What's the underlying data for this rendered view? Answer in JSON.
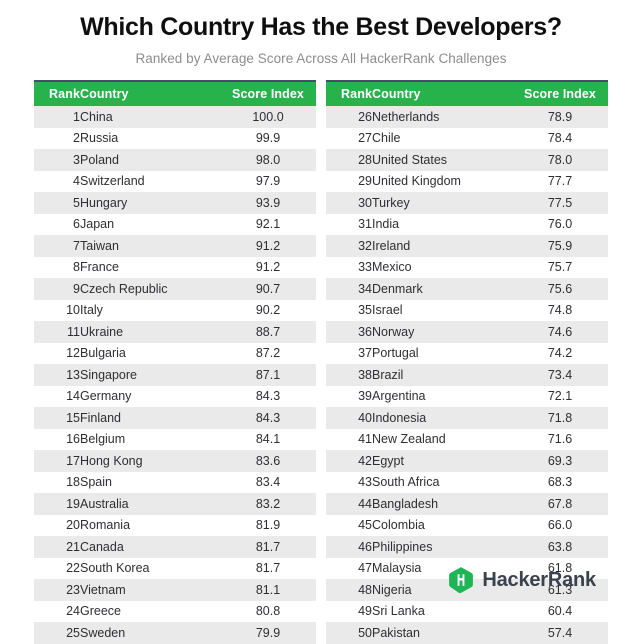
{
  "header": {
    "title": "Which Country Has the Best Developers?",
    "subtitle": "Ranked by Average Score Across All HackerRank Challenges"
  },
  "columns": {
    "rank": "Rank",
    "country": "Country",
    "score": "Score Index"
  },
  "colors": {
    "header_green": "#27b24b",
    "row_shaded": "#eaeaea",
    "row_plain": "#ffffff",
    "logo_green": "#1fb455",
    "logo_text": "#39424e",
    "title_text": "#0f0f0f",
    "subtitle_text": "#8d8d8d",
    "table_top_rule": "#4a4a6a"
  },
  "footer": {
    "logo_name": "HackerRank",
    "logo_letter": "H",
    "logo_icon": "hackerrank-hexagon-icon"
  },
  "chart_data": {
    "type": "table",
    "title": "Which Country Has the Best Developers?",
    "subtitle": "Ranked by Average Score Across All HackerRank Challenges",
    "columns": [
      "Rank",
      "Country",
      "Score Index"
    ],
    "xlabel": "",
    "ylabel": "Score Index",
    "ylim": [
      57.4,
      100.0
    ],
    "categories": [
      "China",
      "Russia",
      "Poland",
      "Switzerland",
      "Hungary",
      "Japan",
      "Taiwan",
      "France",
      "Czech Republic",
      "Italy",
      "Ukraine",
      "Bulgaria",
      "Singapore",
      "Germany",
      "Finland",
      "Belgium",
      "Hong Kong",
      "Spain",
      "Australia",
      "Romania",
      "Canada",
      "South Korea",
      "Vietnam",
      "Greece",
      "Sweden",
      "Netherlands",
      "Chile",
      "United States",
      "United Kingdom",
      "Turkey",
      "India",
      "Ireland",
      "Mexico",
      "Denmark",
      "Israel",
      "Norway",
      "Portugal",
      "Brazil",
      "Argentina",
      "Indonesia",
      "New Zealand",
      "Egypt",
      "South Africa",
      "Bangladesh",
      "Colombia",
      "Philippines",
      "Malaysia",
      "Nigeria",
      "Sri Lanka",
      "Pakistan"
    ],
    "values": [
      100.0,
      99.9,
      98.0,
      97.9,
      93.9,
      92.1,
      91.2,
      91.2,
      90.7,
      90.2,
      88.7,
      87.2,
      87.1,
      84.3,
      84.3,
      84.1,
      83.6,
      83.4,
      83.2,
      81.9,
      81.7,
      81.7,
      81.1,
      80.8,
      79.9,
      78.9,
      78.4,
      78.0,
      77.7,
      77.5,
      76.0,
      75.9,
      75.7,
      75.6,
      74.8,
      74.6,
      74.2,
      73.4,
      72.1,
      71.8,
      71.6,
      69.3,
      68.3,
      67.8,
      66.0,
      63.8,
      61.8,
      61.3,
      60.4,
      57.4
    ]
  },
  "tables": [
    {
      "id": "left",
      "rows": [
        {
          "rank": "1",
          "country": "China",
          "score": "100.0"
        },
        {
          "rank": "2",
          "country": "Russia",
          "score": "99.9"
        },
        {
          "rank": "3",
          "country": "Poland",
          "score": "98.0"
        },
        {
          "rank": "4",
          "country": "Switzerland",
          "score": "97.9"
        },
        {
          "rank": "5",
          "country": "Hungary",
          "score": "93.9"
        },
        {
          "rank": "6",
          "country": "Japan",
          "score": "92.1"
        },
        {
          "rank": "7",
          "country": "Taiwan",
          "score": "91.2"
        },
        {
          "rank": "8",
          "country": "France",
          "score": "91.2"
        },
        {
          "rank": "9",
          "country": "Czech Republic",
          "score": "90.7"
        },
        {
          "rank": "10",
          "country": "Italy",
          "score": "90.2"
        },
        {
          "rank": "11",
          "country": "Ukraine",
          "score": "88.7"
        },
        {
          "rank": "12",
          "country": "Bulgaria",
          "score": "87.2"
        },
        {
          "rank": "13",
          "country": "Singapore",
          "score": "87.1"
        },
        {
          "rank": "14",
          "country": "Germany",
          "score": "84.3"
        },
        {
          "rank": "15",
          "country": "Finland",
          "score": "84.3"
        },
        {
          "rank": "16",
          "country": "Belgium",
          "score": "84.1"
        },
        {
          "rank": "17",
          "country": "Hong Kong",
          "score": "83.6"
        },
        {
          "rank": "18",
          "country": "Spain",
          "score": "83.4"
        },
        {
          "rank": "19",
          "country": "Australia",
          "score": "83.2"
        },
        {
          "rank": "20",
          "country": "Romania",
          "score": "81.9"
        },
        {
          "rank": "21",
          "country": "Canada",
          "score": "81.7"
        },
        {
          "rank": "22",
          "country": "South Korea",
          "score": "81.7"
        },
        {
          "rank": "23",
          "country": "Vietnam",
          "score": "81.1"
        },
        {
          "rank": "24",
          "country": "Greece",
          "score": "80.8"
        },
        {
          "rank": "25",
          "country": "Sweden",
          "score": "79.9"
        }
      ]
    },
    {
      "id": "right",
      "rows": [
        {
          "rank": "26",
          "country": "Netherlands",
          "score": "78.9"
        },
        {
          "rank": "27",
          "country": "Chile",
          "score": "78.4"
        },
        {
          "rank": "28",
          "country": "United States",
          "score": "78.0"
        },
        {
          "rank": "29",
          "country": "United Kingdom",
          "score": "77.7"
        },
        {
          "rank": "30",
          "country": "Turkey",
          "score": "77.5"
        },
        {
          "rank": "31",
          "country": "India",
          "score": "76.0"
        },
        {
          "rank": "32",
          "country": "Ireland",
          "score": "75.9"
        },
        {
          "rank": "33",
          "country": "Mexico",
          "score": "75.7"
        },
        {
          "rank": "34",
          "country": "Denmark",
          "score": "75.6"
        },
        {
          "rank": "35",
          "country": "Israel",
          "score": "74.8"
        },
        {
          "rank": "36",
          "country": "Norway",
          "score": "74.6"
        },
        {
          "rank": "37",
          "country": "Portugal",
          "score": "74.2"
        },
        {
          "rank": "38",
          "country": "Brazil",
          "score": "73.4"
        },
        {
          "rank": "39",
          "country": "Argentina",
          "score": "72.1"
        },
        {
          "rank": "40",
          "country": "Indonesia",
          "score": "71.8"
        },
        {
          "rank": "41",
          "country": "New Zealand",
          "score": "71.6"
        },
        {
          "rank": "42",
          "country": "Egypt",
          "score": "69.3"
        },
        {
          "rank": "43",
          "country": "South Africa",
          "score": "68.3"
        },
        {
          "rank": "44",
          "country": "Bangladesh",
          "score": "67.8"
        },
        {
          "rank": "45",
          "country": "Colombia",
          "score": "66.0"
        },
        {
          "rank": "46",
          "country": "Philippines",
          "score": "63.8"
        },
        {
          "rank": "47",
          "country": "Malaysia",
          "score": "61.8"
        },
        {
          "rank": "48",
          "country": "Nigeria",
          "score": "61.3"
        },
        {
          "rank": "49",
          "country": "Sri Lanka",
          "score": "60.4"
        },
        {
          "rank": "50",
          "country": "Pakistan",
          "score": "57.4"
        }
      ]
    }
  ]
}
